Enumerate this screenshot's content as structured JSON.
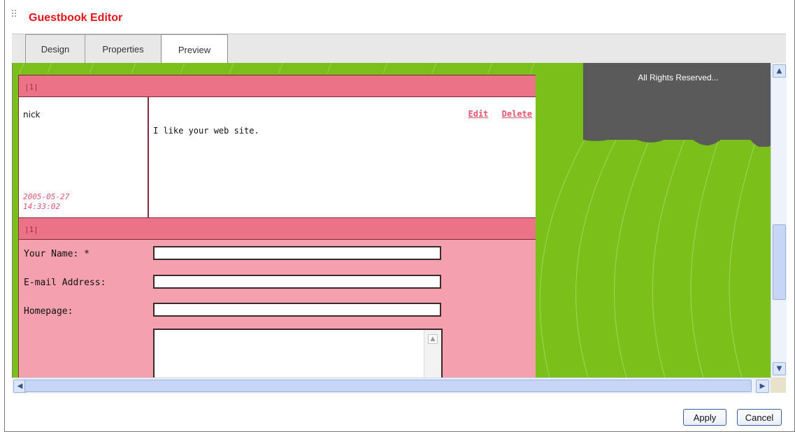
{
  "window": {
    "title": "Guestbook Editor"
  },
  "tabs": [
    {
      "label": "Design"
    },
    {
      "label": "Properties"
    },
    {
      "label": "Preview"
    }
  ],
  "guestbook": {
    "entry_header": "|1|",
    "entry": {
      "author": "nick",
      "date": "2005-05-27",
      "time": "14:33:02",
      "message": "I like your web site.",
      "edit_label": "Edit",
      "delete_label": "Delete"
    },
    "form_header": "|1|",
    "form": {
      "name_label": "Your Name: *",
      "email_label": "E-mail Address:",
      "homepage_label": "Homepage:"
    }
  },
  "side_panel": {
    "rights_text": "All Rights Reserved..."
  },
  "buttons": {
    "apply": "Apply",
    "cancel": "Cancel"
  },
  "colors": {
    "title": "#e6141b",
    "green_background": "#7bbf1a",
    "header_pink": "#ec7387",
    "form_pink": "#f5a0ae",
    "link_pink": "#e25570",
    "gray_box": "#5a5a5a"
  },
  "icons": [
    "grip-icon",
    "scroll-up-arrow-icon",
    "scroll-down-arrow-icon",
    "scroll-left-arrow-icon",
    "scroll-right-arrow-icon",
    "textarea-up-arrow-icon"
  ]
}
